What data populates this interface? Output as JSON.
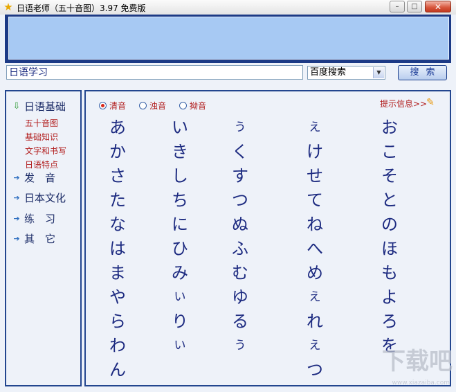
{
  "window": {
    "title": "日语老师（五十音图）3.97 免费版",
    "minimize": "–",
    "maximize": "□",
    "close": "✕"
  },
  "search": {
    "query": "日语学习",
    "engine": "百度搜索",
    "button": "搜索"
  },
  "sidebar": {
    "items": [
      {
        "label": "日语基础",
        "icon": "arrow-down-icon",
        "expanded": true
      },
      {
        "label": "发　音",
        "icon": "arrow-right-icon"
      },
      {
        "label": "日本文化",
        "icon": "arrow-right-icon"
      },
      {
        "label": "练　习",
        "icon": "arrow-right-icon"
      },
      {
        "label": "其　它",
        "icon": "arrow-right-icon"
      }
    ],
    "subitems": [
      "五十音图",
      "基础知识",
      "文字和书写",
      "日语特点"
    ]
  },
  "content": {
    "radios": [
      {
        "label": "清音",
        "selected": true
      },
      {
        "label": "浊音",
        "selected": false
      },
      {
        "label": "拗音",
        "selected": false
      }
    ],
    "hint": "提示信息>>",
    "kana": [
      [
        "あ",
        "い",
        "う",
        "え",
        "お"
      ],
      [
        "か",
        "き",
        "く",
        "け",
        "こ"
      ],
      [
        "さ",
        "し",
        "す",
        "せ",
        "そ"
      ],
      [
        "た",
        "ち",
        "つ",
        "て",
        "と"
      ],
      [
        "な",
        "に",
        "ぬ",
        "ね",
        "の"
      ],
      [
        "は",
        "ひ",
        "ふ",
        "へ",
        "ほ"
      ],
      [
        "ま",
        "み",
        "む",
        "め",
        "も"
      ],
      [
        "や",
        "い",
        "ゆ",
        "え",
        "よ"
      ],
      [
        "ら",
        "り",
        "る",
        "れ",
        "ろ"
      ],
      [
        "わ",
        "い",
        "う",
        "え",
        "を"
      ],
      [
        "ん",
        "",
        "",
        "つ",
        ""
      ]
    ]
  },
  "watermark": {
    "text": "下载吧",
    "sub": "www.xiazaiba.com"
  },
  "colors": {
    "frame": "#23468f",
    "kana": "#1c2a80",
    "link": "#b11c1c",
    "banner": "#a7c9f3"
  }
}
